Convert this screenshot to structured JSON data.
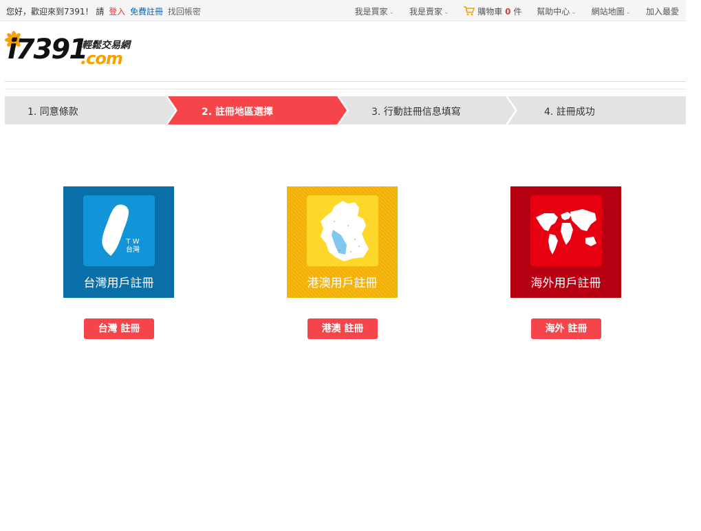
{
  "topbar": {
    "greeting": "您好，歡迎來到7391！ 請",
    "login": "登入",
    "register": "免費註冊",
    "recover": "找回帳密",
    "buyer": "我是買家",
    "seller": "我是賣家",
    "cart_label": "購物車",
    "cart_count": "0",
    "cart_unit": "件",
    "help": "幫助中心",
    "sitemap": "網站地圖",
    "favorite": "加入最愛"
  },
  "logo": {
    "main": "i7391",
    "sub": "輕鬆交易網",
    "com": ".com"
  },
  "steps": [
    {
      "label": "1. 同意條款",
      "active": false
    },
    {
      "label": "2. 註冊地區選擇",
      "active": true
    },
    {
      "label": "3. 行動註冊信息填寫",
      "active": false
    },
    {
      "label": "4. 註冊成功",
      "active": false
    }
  ],
  "regions": {
    "tw": {
      "caption": "台灣用戶註冊",
      "button": "台灣 註冊",
      "tag_en": "T W",
      "tag_zh": "台灣",
      "icon": "taiwan-map-icon"
    },
    "hk": {
      "caption": "港澳用戶註冊",
      "button": "港澳 註冊",
      "icon": "hongkong-macau-map-icon"
    },
    "os": {
      "caption": "海外用戶註冊",
      "button": "海外 註冊",
      "icon": "world-map-icon"
    }
  },
  "colors": {
    "accent": "#f5444a",
    "step_active": "#f5444a",
    "step_inactive": "#e3e3e3",
    "tw_bg": "#0a6fa8",
    "hk_bg": "#f3b000",
    "os_bg": "#b60012"
  }
}
